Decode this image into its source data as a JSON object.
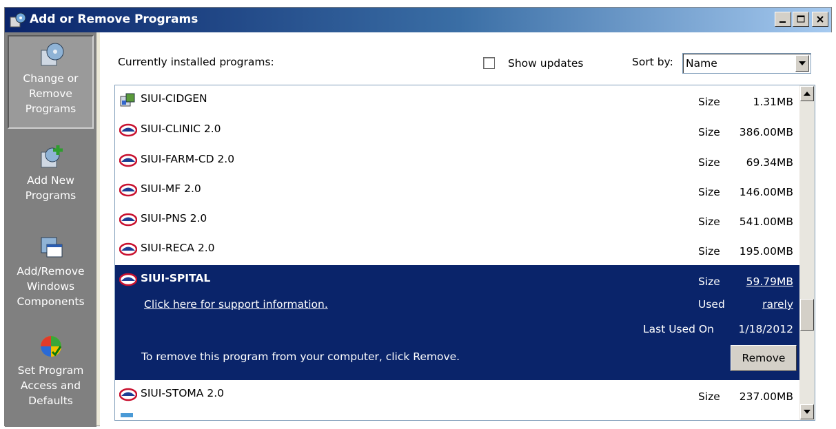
{
  "window": {
    "title": "Add or Remove Programs"
  },
  "sidebar": {
    "items": [
      {
        "label": "Change or\nRemove\nPrograms"
      },
      {
        "label": "Add New\nPrograms"
      },
      {
        "label": "Add/Remove\nWindows\nComponents"
      },
      {
        "label": "Set Program\nAccess and\nDefaults"
      }
    ]
  },
  "header": {
    "installed_label": "Currently installed programs:",
    "show_updates_label": "Show updates",
    "sort_by_label": "Sort by:",
    "sort_value": "Name"
  },
  "programs": [
    {
      "name": "SIUI-CIDGEN",
      "size_label": "Size",
      "size": "1.31MB",
      "icon": "installer-icon"
    },
    {
      "name": "SIUI-CLINIC 2.0",
      "size_label": "Size",
      "size": "386.00MB",
      "icon": "siui-logo-icon"
    },
    {
      "name": "SIUI-FARM-CD 2.0",
      "size_label": "Size",
      "size": "69.34MB",
      "icon": "siui-logo-icon"
    },
    {
      "name": "SIUI-MF 2.0",
      "size_label": "Size",
      "size": "146.00MB",
      "icon": "siui-logo-icon"
    },
    {
      "name": "SIUI-PNS 2.0",
      "size_label": "Size",
      "size": "541.00MB",
      "icon": "siui-logo-icon"
    },
    {
      "name": "SIUI-RECA 2.0",
      "size_label": "Size",
      "size": "195.00MB",
      "icon": "siui-logo-icon"
    }
  ],
  "selected": {
    "name": "SIUI-SPITAL",
    "size_label": "Size",
    "size": "59.79MB",
    "support_link": "Click here for support information.",
    "used_label": "Used",
    "used_value": "rarely",
    "last_used_label": "Last Used On",
    "last_used_value": "1/18/2012",
    "remove_text": "To remove this program from your computer, click Remove.",
    "remove_button": "Remove"
  },
  "after": [
    {
      "name": "SIUI-STOMA 2.0",
      "size_label": "Size",
      "size": "237.00MB",
      "icon": "siui-logo-icon"
    }
  ]
}
